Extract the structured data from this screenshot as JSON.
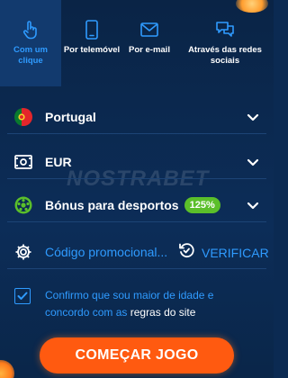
{
  "tabs": [
    {
      "label": "Com um clique",
      "icon": "hand-pointer-icon",
      "active": true
    },
    {
      "label": "Por telemóvel",
      "icon": "mobile-phone-icon",
      "active": false
    },
    {
      "label": "Por e-mail",
      "icon": "envelope-icon",
      "active": false
    },
    {
      "label": "Através das redes sociais",
      "icon": "chat-bubbles-icon",
      "active": false
    }
  ],
  "watermark": "NOSTRABET",
  "country": {
    "value": "Portugal",
    "icon": "portugal-flag-icon"
  },
  "currency": {
    "value": "EUR",
    "icon": "currency-icon"
  },
  "bonus": {
    "label": "Bónus para desportos",
    "badge": "125%",
    "icon": "soccer-ball-icon"
  },
  "promo": {
    "placeholder": "Código promocional...",
    "verify_label": "VERIFICAR",
    "icon": "gear-icon",
    "verify_icon": "refresh-check-icon"
  },
  "consent": {
    "text": "Confirmo que sou maior de idade e concordo com as ",
    "link": "regras do site",
    "checked": true
  },
  "start_button": "COMEÇAR JOGO",
  "colors": {
    "accent": "#2f9bff",
    "background": "#0b2a52",
    "button": "#ff5a10",
    "badge": "#5bbf2a"
  }
}
